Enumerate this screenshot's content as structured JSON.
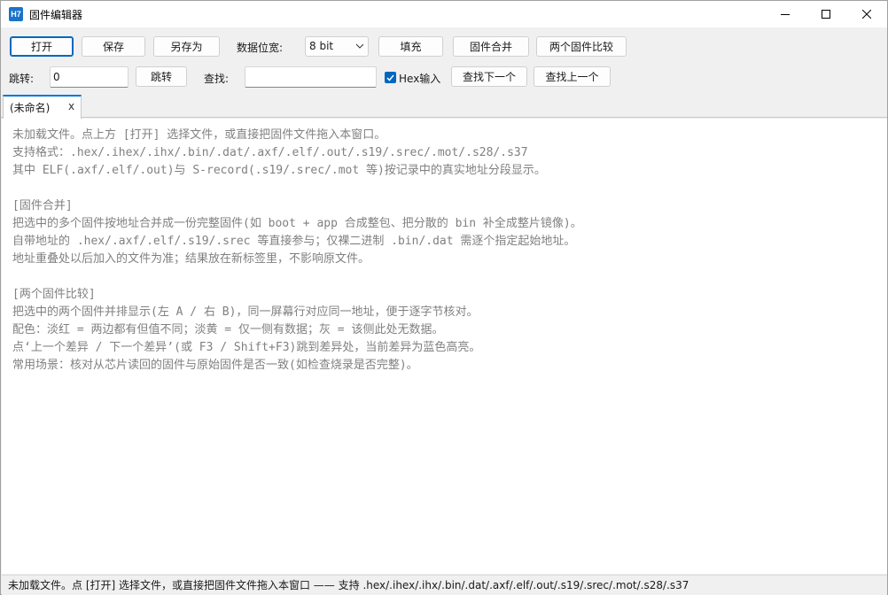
{
  "window": {
    "icon_text": "H7",
    "title": "固件编辑器"
  },
  "toolbar": {
    "open": "打开",
    "save": "保存",
    "save_as": "另存为",
    "data_width_label": "数据位宽:",
    "data_width_value": "8 bit",
    "fill": "填充",
    "merge": "固件合并",
    "compare": "两个固件比较"
  },
  "search_row": {
    "jump_label": "跳转:",
    "jump_value": "0",
    "jump_button": "跳转",
    "find_label": "查找:",
    "find_value": "",
    "hex_input_label": "Hex输入",
    "hex_input_checked": true,
    "find_next": "查找下一个",
    "find_prev": "查找上一个"
  },
  "tabs": [
    {
      "label": "(未命名)",
      "close": "x"
    }
  ],
  "content_lines": [
    "未加载文件。点上方 [打开] 选择文件，或直接把固件文件拖入本窗口。",
    "支持格式：.hex/.ihex/.ihx/.bin/.dat/.axf/.elf/.out/.s19/.srec/.mot/.s28/.s37",
    "其中 ELF(.axf/.elf/.out)与 S-record(.s19/.srec/.mot 等)按记录中的真实地址分段显示。",
    "",
    "[固件合并]",
    "把选中的多个固件按地址合并成一份完整固件(如 boot + app 合成整包、把分散的 bin 补全成整片镜像)。",
    "自带地址的 .hex/.axf/.elf/.s19/.srec 等直接参与；仅裸二进制 .bin/.dat 需逐个指定起始地址。",
    "地址重叠处以后加入的文件为准；结果放在新标签里，不影响原文件。",
    "",
    "[两个固件比较]",
    "把选中的两个固件并排显示(左 A / 右 B)，同一屏幕行对应同一地址，便于逐字节核对。",
    "配色：淡红 = 两边都有但值不同；淡黄 = 仅一侧有数据；灰 = 该侧此处无数据。",
    "点‘上一个差异 / 下一个差异’(或 F3 / Shift+F3)跳到差异处，当前差异为蓝色高亮。",
    "常用场景：核对从芯片读回的固件与原始固件是否一致(如检查烧录是否完整)。"
  ],
  "status": {
    "text": "未加载文件。点 [打开] 选择文件，或直接把固件文件拖入本窗口 —— 支持 .hex/.ihex/.ihx/.bin/.dat/.axf/.elf/.out/.s19/.srec/.mot/.s28/.s37"
  },
  "colors": {
    "accent": "#0067c0",
    "tab_accent": "#0078d4",
    "content_text": "#808080"
  }
}
